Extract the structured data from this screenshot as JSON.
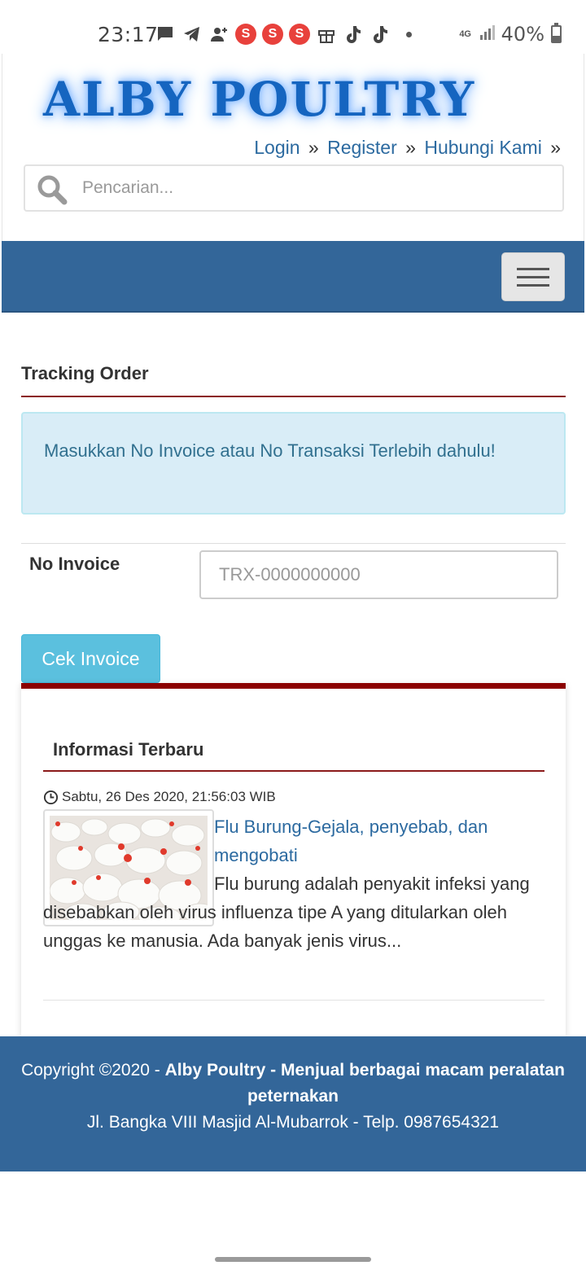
{
  "status_bar": {
    "time": "23:17",
    "network": "4G",
    "battery": "40%",
    "notification_icons": [
      "chat-icon",
      "telegram-icon",
      "add-person-icon",
      "shopee-s-icon",
      "shopee-s-icon",
      "shopee-s-icon",
      "gift-icon",
      "tiktok-icon",
      "tiktok-icon",
      "dot-icon"
    ]
  },
  "header": {
    "logo_text": "ALBY POULTRY",
    "links": [
      {
        "label": "Login"
      },
      {
        "label": "Register"
      },
      {
        "label": "Hubungi Kami"
      }
    ],
    "separator": "»",
    "search": {
      "placeholder": "Pencarian..."
    }
  },
  "tracking": {
    "title": "Tracking Order",
    "alert": "Masukkan No Invoice atau No Transaksi Terlebih dahulu!",
    "invoice_label": "No Invoice",
    "invoice_placeholder": "TRX-0000000000",
    "button_label": "Cek Invoice"
  },
  "info": {
    "title": "Informasi Terbaru",
    "post": {
      "date": "Sabtu, 26 Des 2020, 21:56:03 WIB",
      "title": "Flu Burung-Gejala, penyebab, dan mengobati",
      "excerpt": "Flu burung adalah penyakit infeksi yang disebabkan oleh virus influenza tipe A yang ditularkan oleh unggas ke manusia. Ada banyak jenis virus..."
    }
  },
  "footer": {
    "copyright_prefix": "Copyright ©2020 - ",
    "copyright_bold": "Alby Poultry - Menjual berbagai macam peralatan peternakan",
    "address": "Jl. Bangka VIII Masjid Al-Mubarrok - Telp. 0987654321"
  },
  "colors": {
    "brand_blue": "#336699",
    "accent_red": "#8b1a1a",
    "link_blue": "#2c6aa0",
    "info_button": "#5bc0de",
    "alert_bg": "#d9edf7"
  }
}
